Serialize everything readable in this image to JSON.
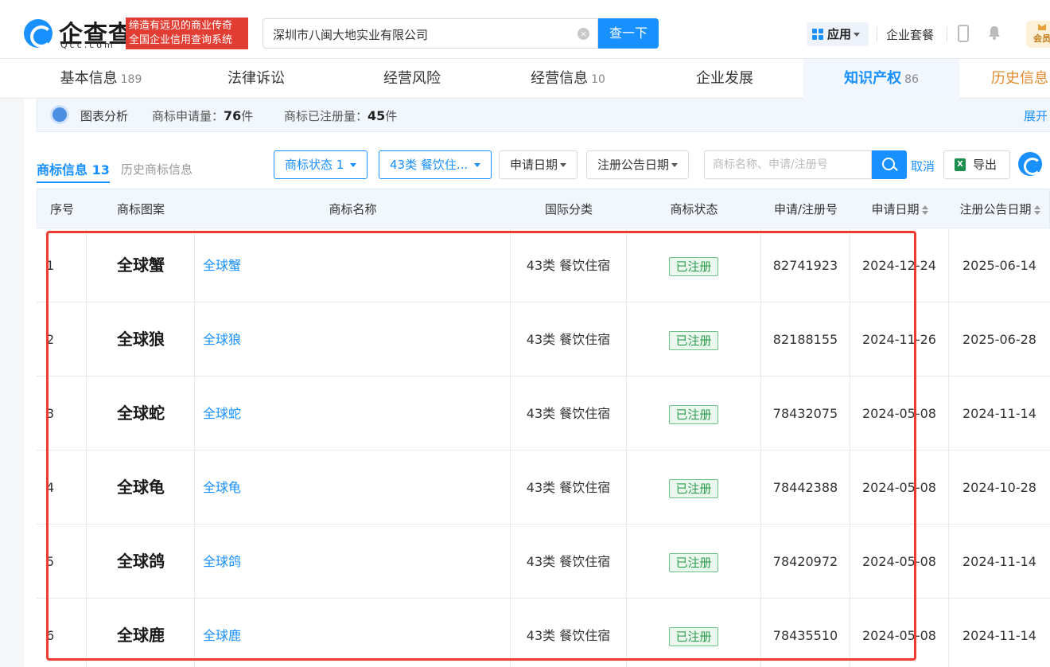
{
  "header": {
    "logo_text": "企查查",
    "logo_sub": "Qcc.com",
    "slogan_line1": "缔造有远见的商业传奇",
    "slogan_line2": "全国企业信用查询系统",
    "search_value": "深圳市八闽大地实业有限公司",
    "search_button": "查一下",
    "app_button": "应用",
    "enterprise_package": "企业套餐",
    "vip_label": "会员"
  },
  "tabs": [
    {
      "label": "基本信息",
      "count": "189"
    },
    {
      "label": "法律诉讼",
      "count": ""
    },
    {
      "label": "经营风险",
      "count": ""
    },
    {
      "label": "经营信息",
      "count": "10"
    },
    {
      "label": "企业发展",
      "count": ""
    },
    {
      "label": "知识产权",
      "count": "86"
    },
    {
      "label": "历史信息",
      "count": ""
    }
  ],
  "stats": {
    "chart_label": "图表分析",
    "apply_label": "商标申请量：",
    "apply_value": "76",
    "apply_unit": "件",
    "registered_label": "商标已注册量：",
    "registered_value": "45",
    "registered_unit": "件",
    "expand": "展开"
  },
  "subtabs": {
    "active_label": "商标信息",
    "active_count": "13",
    "history_label": "历史商标信息"
  },
  "filters": {
    "status": "商标状态 1",
    "category": "43类 餐饮住...",
    "apply_date": "申请日期",
    "notice_date": "注册公告日期",
    "search_placeholder": "商标名称、申请/注册号",
    "cancel": "取消",
    "export": "导出"
  },
  "table": {
    "headers": [
      "序号",
      "商标图案",
      "商标名称",
      "国际分类",
      "商标状态",
      "申请/注册号",
      "申请日期",
      "注册公告日期"
    ],
    "rows": [
      {
        "no": "1",
        "logo": "全球蟹",
        "name": "全球蟹",
        "class": "43类 餐饮住宿",
        "status": "已注册",
        "reg_no": "82741923",
        "apply_date": "2024-12-24",
        "notice_date": "2025-06-14"
      },
      {
        "no": "2",
        "logo": "全球狼",
        "name": "全球狼",
        "class": "43类 餐饮住宿",
        "status": "已注册",
        "reg_no": "82188155",
        "apply_date": "2024-11-26",
        "notice_date": "2025-06-28"
      },
      {
        "no": "3",
        "logo": "全球蛇",
        "name": "全球蛇",
        "class": "43类 餐饮住宿",
        "status": "已注册",
        "reg_no": "78432075",
        "apply_date": "2024-05-08",
        "notice_date": "2024-11-14"
      },
      {
        "no": "4",
        "logo": "全球龟",
        "name": "全球龟",
        "class": "43类 餐饮住宿",
        "status": "已注册",
        "reg_no": "78442388",
        "apply_date": "2024-05-08",
        "notice_date": "2024-10-28"
      },
      {
        "no": "5",
        "logo": "全球鸽",
        "name": "全球鸽",
        "class": "43类 餐饮住宿",
        "status": "已注册",
        "reg_no": "78420972",
        "apply_date": "2024-05-08",
        "notice_date": "2024-11-14"
      },
      {
        "no": "6",
        "logo": "全球鹿",
        "name": "全球鹿",
        "class": "43类 餐饮住宿",
        "status": "已注册",
        "reg_no": "78435510",
        "apply_date": "2024-05-08",
        "notice_date": "2024-11-14"
      }
    ]
  },
  "colors": {
    "accent": "#1890ff",
    "highlight_box": "#f03a2e",
    "status_green": "#2d9c4e",
    "slogan_red": "#e23d33"
  }
}
